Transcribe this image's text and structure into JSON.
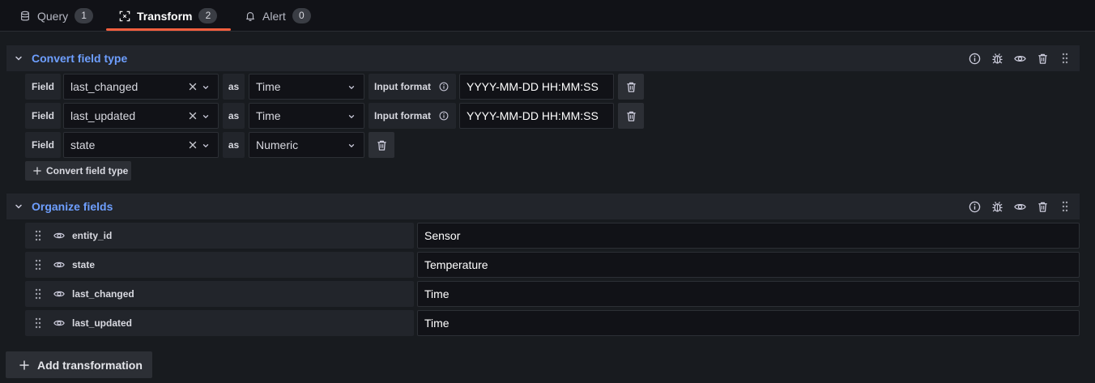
{
  "tabs": [
    {
      "label": "Query",
      "count": "1",
      "icon": "database-icon"
    },
    {
      "label": "Transform",
      "count": "2",
      "icon": "transform-icon"
    },
    {
      "label": "Alert",
      "count": "0",
      "icon": "bell-icon"
    }
  ],
  "colors": {
    "accent": "#f55f3e",
    "section_title": "#6e9fff",
    "background": "#181b1f"
  },
  "convert": {
    "title": "Convert field type",
    "rows": [
      {
        "field_label": "Field",
        "field": "last_changed",
        "as": "as",
        "type": "Time",
        "format_label": "Input format",
        "format": "YYYY-MM-DD HH:MM:SS"
      },
      {
        "field_label": "Field",
        "field": "last_updated",
        "as": "as",
        "type": "Time",
        "format_label": "Input format",
        "format": "YYYY-MM-DD HH:MM:SS"
      },
      {
        "field_label": "Field",
        "field": "state",
        "as": "as",
        "type": "Numeric"
      }
    ],
    "add_label": "Convert field type"
  },
  "organize": {
    "title": "Organize fields",
    "rows": [
      {
        "name": "entity_id",
        "rename": "Sensor"
      },
      {
        "name": "state",
        "rename": "Temperature"
      },
      {
        "name": "last_changed",
        "rename": "Time"
      },
      {
        "name": "last_updated",
        "rename": "Time"
      }
    ]
  },
  "add_transformation": "Add transformation"
}
